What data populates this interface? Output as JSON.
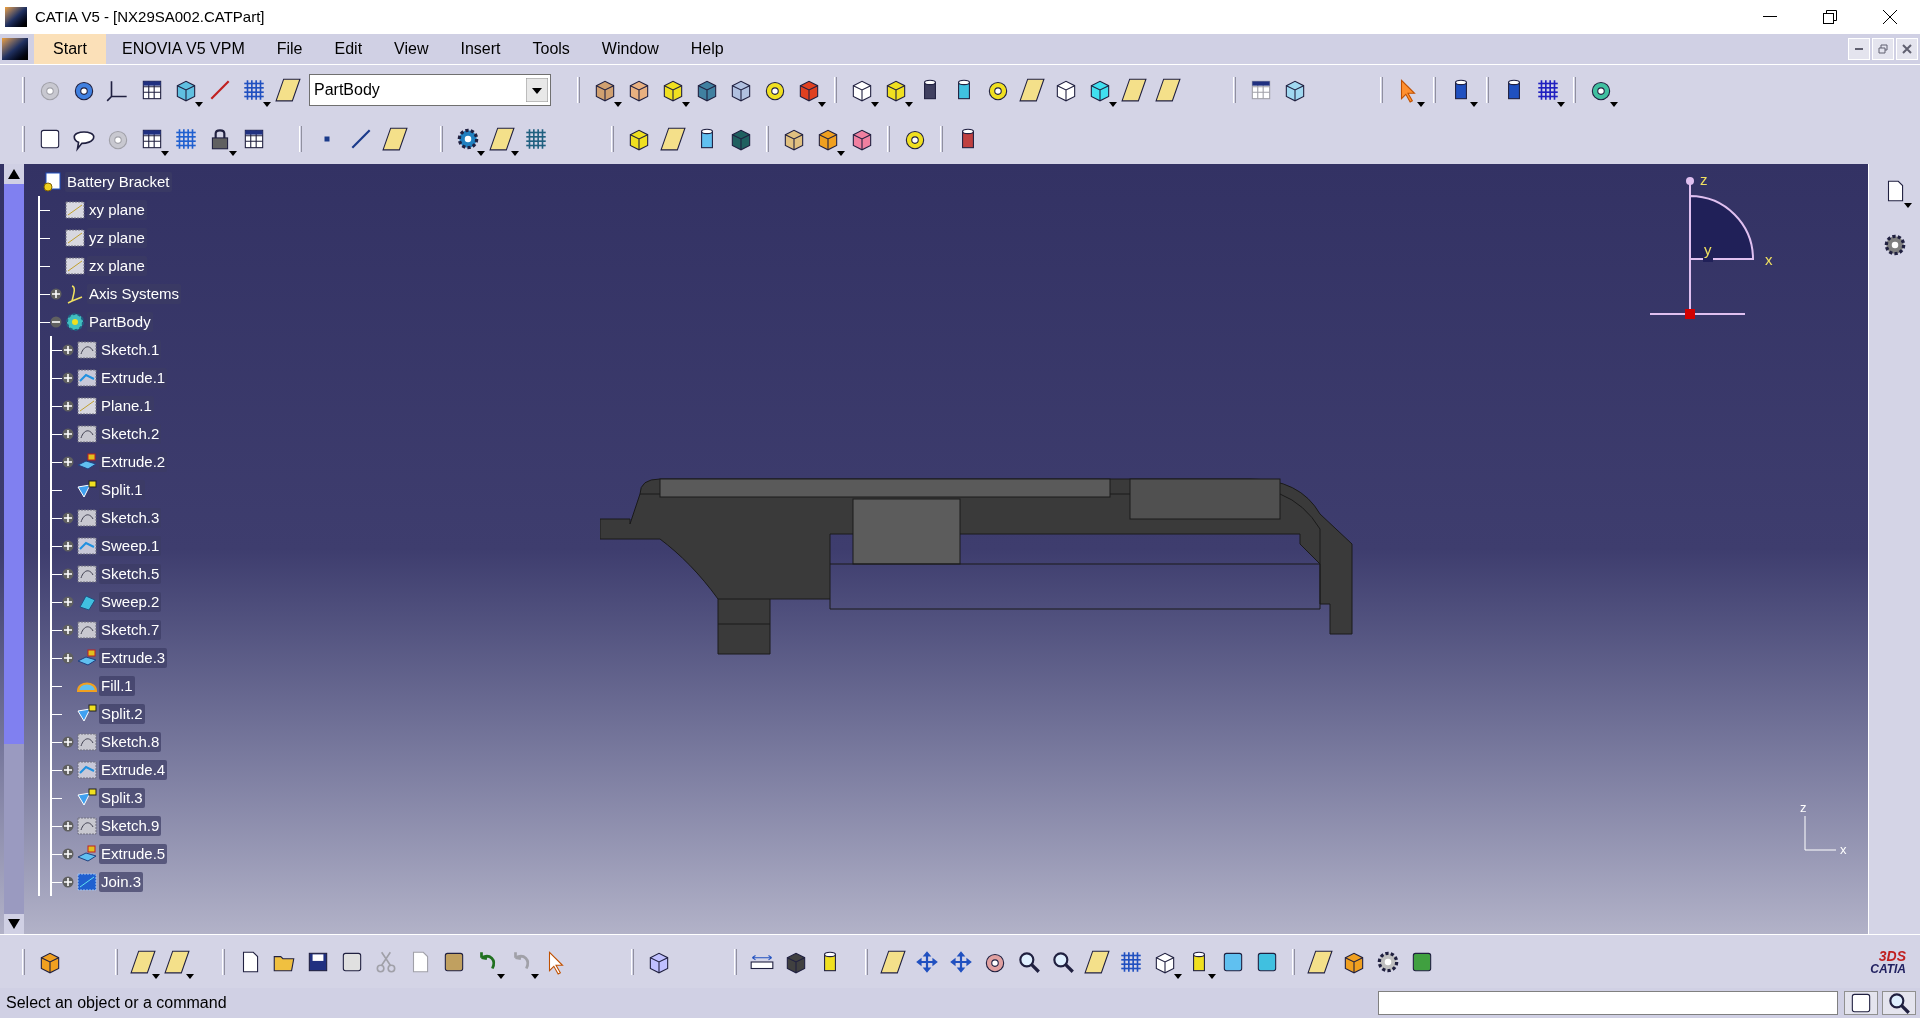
{
  "window": {
    "title": "CATIA V5 - [NX29SA002.CATPart]"
  },
  "menu": [
    {
      "label": "Start",
      "selected": true
    },
    {
      "label": "ENOVIA V5 VPM",
      "selected": false
    },
    {
      "label": "File",
      "selected": false
    },
    {
      "label": "Edit",
      "selected": false
    },
    {
      "label": "View",
      "selected": false
    },
    {
      "label": "Insert",
      "selected": false
    },
    {
      "label": "Tools",
      "selected": false
    },
    {
      "label": "Window",
      "selected": false
    },
    {
      "label": "Help",
      "selected": false
    }
  ],
  "body_selector": {
    "value": "PartBody"
  },
  "tree": {
    "label": "Battery Bracket",
    "children": [
      {
        "label": "xy plane",
        "kind": "plane"
      },
      {
        "label": "yz plane",
        "kind": "plane"
      },
      {
        "label": "zx plane",
        "kind": "plane"
      },
      {
        "label": "Axis Systems",
        "kind": "axis",
        "expanded": false
      },
      {
        "label": "PartBody",
        "kind": "body",
        "expanded": true,
        "children": [
          {
            "label": "Sketch.1",
            "kind": "sketch",
            "expanded": false
          },
          {
            "label": "Extrude.1",
            "kind": "surface",
            "expanded": false
          },
          {
            "label": "Plane.1",
            "kind": "plane",
            "expanded": false
          },
          {
            "label": "Sketch.2",
            "kind": "sketch",
            "expanded": false
          },
          {
            "label": "Extrude.2",
            "kind": "extrude",
            "expanded": false
          },
          {
            "label": "Split.1",
            "kind": "split"
          },
          {
            "label": "Sketch.3",
            "kind": "sketch",
            "expanded": false
          },
          {
            "label": "Sweep.1",
            "kind": "surface",
            "expanded": false
          },
          {
            "label": "Sketch.5",
            "kind": "sketch",
            "expanded": false
          },
          {
            "label": "Sweep.2",
            "kind": "sweep",
            "expanded": false
          },
          {
            "label": "Sketch.7",
            "kind": "sketch",
            "expanded": false
          },
          {
            "label": "Extrude.3",
            "kind": "extrude",
            "expanded": false
          },
          {
            "label": "Fill.1",
            "kind": "fill"
          },
          {
            "label": "Split.2",
            "kind": "split"
          },
          {
            "label": "Sketch.8",
            "kind": "sketch",
            "expanded": false
          },
          {
            "label": "Extrude.4",
            "kind": "surface",
            "expanded": false
          },
          {
            "label": "Split.3",
            "kind": "split"
          },
          {
            "label": "Sketch.9",
            "kind": "sketch",
            "expanded": false
          },
          {
            "label": "Extrude.5",
            "kind": "extrude",
            "expanded": false
          },
          {
            "label": "Join.3",
            "kind": "join",
            "expanded": false
          }
        ]
      }
    ]
  },
  "compass": {
    "z": "z",
    "x": "x",
    "y": "y"
  },
  "axis_triad": {
    "z": "z",
    "x": "x"
  },
  "logo": {
    "mark": "3DS",
    "text": "CATIA"
  },
  "status_bar": {
    "message": "Select an object or a command"
  }
}
